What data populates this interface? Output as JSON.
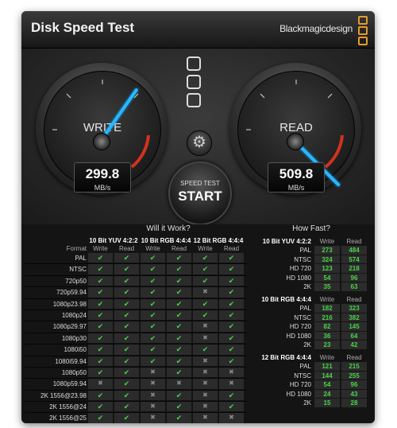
{
  "app": {
    "title": "Disk Speed Test",
    "brand": "Blackmagicdesign",
    "brand_color": "#e59a2e"
  },
  "write_gauge": {
    "label": "WRITE",
    "value": "299.8",
    "unit": "MB/s"
  },
  "read_gauge": {
    "label": "READ",
    "value": "509.8",
    "unit": "MB/s"
  },
  "start_button": {
    "sub_label": "SPEED TEST",
    "label": "START"
  },
  "will_it_work": {
    "title": "Will it Work?",
    "format_header": "Format",
    "groups": [
      "10 Bit YUV 4:2:2",
      "10 Bit RGB 4:4:4",
      "12 Bit RGB 4:4:4"
    ],
    "write_label": "Write",
    "read_label": "Read",
    "rows": [
      {
        "format": "PAL",
        "cells": [
          1,
          1,
          1,
          1,
          1,
          1
        ]
      },
      {
        "format": "NTSC",
        "cells": [
          1,
          1,
          1,
          1,
          1,
          1
        ]
      },
      {
        "format": "720p50",
        "cells": [
          1,
          1,
          1,
          1,
          1,
          1
        ]
      },
      {
        "format": "720p59.94",
        "cells": [
          1,
          1,
          1,
          1,
          0,
          1
        ]
      },
      {
        "format": "1080p23.98",
        "cells": [
          1,
          1,
          1,
          1,
          1,
          1
        ]
      },
      {
        "format": "1080p24",
        "cells": [
          1,
          1,
          1,
          1,
          1,
          1
        ]
      },
      {
        "format": "1080p29.97",
        "cells": [
          1,
          1,
          1,
          1,
          0,
          1
        ]
      },
      {
        "format": "1080p30",
        "cells": [
          1,
          1,
          1,
          1,
          0,
          1
        ]
      },
      {
        "format": "1080i50",
        "cells": [
          1,
          1,
          1,
          1,
          1,
          1
        ]
      },
      {
        "format": "1080i59.94",
        "cells": [
          1,
          1,
          1,
          1,
          0,
          1
        ]
      },
      {
        "format": "1080p50",
        "cells": [
          1,
          1,
          0,
          1,
          0,
          0
        ]
      },
      {
        "format": "1080p59.94",
        "cells": [
          0,
          1,
          0,
          0,
          0,
          0
        ]
      },
      {
        "format": "2K 1556@23.98",
        "cells": [
          1,
          1,
          0,
          1,
          0,
          1
        ]
      },
      {
        "format": "2K 1556@24",
        "cells": [
          1,
          1,
          0,
          1,
          0,
          1
        ]
      },
      {
        "format": "2K 1556@25",
        "cells": [
          1,
          1,
          0,
          1,
          0,
          0
        ]
      }
    ]
  },
  "how_fast": {
    "title": "How Fast?",
    "write_label": "Write",
    "read_label": "Read",
    "groups": [
      {
        "name": "10 Bit YUV 4:2:2",
        "rows": [
          {
            "label": "PAL",
            "write": "273",
            "read": "484"
          },
          {
            "label": "NTSC",
            "write": "324",
            "read": "574"
          },
          {
            "label": "HD 720",
            "write": "123",
            "read": "218"
          },
          {
            "label": "HD 1080",
            "write": "54",
            "read": "96"
          },
          {
            "label": "2K",
            "write": "35",
            "read": "63"
          }
        ]
      },
      {
        "name": "10 Bit RGB 4:4:4",
        "rows": [
          {
            "label": "PAL",
            "write": "182",
            "read": "323"
          },
          {
            "label": "NTSC",
            "write": "216",
            "read": "382"
          },
          {
            "label": "HD 720",
            "write": "82",
            "read": "145"
          },
          {
            "label": "HD 1080",
            "write": "36",
            "read": "64"
          },
          {
            "label": "2K",
            "write": "23",
            "read": "42"
          }
        ]
      },
      {
        "name": "12 Bit RGB 4:4:4",
        "rows": [
          {
            "label": "PAL",
            "write": "121",
            "read": "215"
          },
          {
            "label": "NTSC",
            "write": "144",
            "read": "255"
          },
          {
            "label": "HD 720",
            "write": "54",
            "read": "96"
          },
          {
            "label": "HD 1080",
            "write": "24",
            "read": "43"
          },
          {
            "label": "2K",
            "write": "15",
            "read": "28"
          }
        ]
      }
    ]
  }
}
